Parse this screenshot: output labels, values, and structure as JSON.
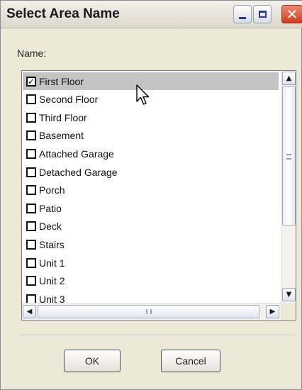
{
  "window": {
    "title": "Select Area Name",
    "controls": {
      "minimize": "minimize-icon",
      "maximize": "maximize-icon",
      "close": "close-icon"
    }
  },
  "form": {
    "name_label": "Name:"
  },
  "areas": [
    {
      "label": "First Floor",
      "checked": true,
      "selected": true
    },
    {
      "label": "Second Floor",
      "checked": false,
      "selected": false
    },
    {
      "label": "Third Floor",
      "checked": false,
      "selected": false
    },
    {
      "label": "Basement",
      "checked": false,
      "selected": false
    },
    {
      "label": "Attached Garage",
      "checked": false,
      "selected": false
    },
    {
      "label": "Detached Garage",
      "checked": false,
      "selected": false
    },
    {
      "label": "Porch",
      "checked": false,
      "selected": false
    },
    {
      "label": "Patio",
      "checked": false,
      "selected": false
    },
    {
      "label": "Deck",
      "checked": false,
      "selected": false
    },
    {
      "label": "Stairs",
      "checked": false,
      "selected": false
    },
    {
      "label": "Unit 1",
      "checked": false,
      "selected": false
    },
    {
      "label": "Unit 2",
      "checked": false,
      "selected": false
    },
    {
      "label": "Unit 3",
      "checked": false,
      "selected": false
    }
  ],
  "buttons": {
    "ok": "OK",
    "cancel": "Cancel"
  },
  "colors": {
    "dialog_bg": "#ece9d8",
    "selection_bg": "#c3c3c3",
    "close_button": "#cf3a1c"
  }
}
